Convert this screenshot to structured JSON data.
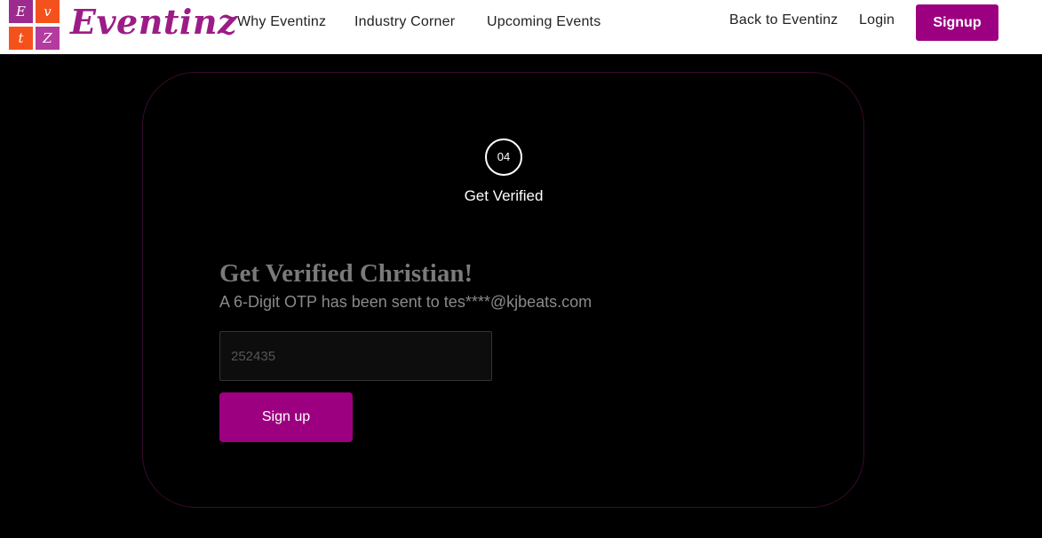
{
  "header": {
    "logo": {
      "tiles": [
        "E",
        "v",
        "t",
        "Z"
      ],
      "text": "Eventinz",
      "brand_color": "#9c1c87"
    },
    "nav": {
      "why": "Why Eventinz",
      "industry": "Industry Corner",
      "upcoming": "Upcoming Events"
    },
    "back_link": "Back to Eventinz",
    "login": "Login",
    "signup": "Signup"
  },
  "card": {
    "step": {
      "number": "04",
      "label": "Get Verified"
    },
    "heading": "Get Verified Christian!",
    "subtext": "A 6-Digit OTP has been sent to tes****@kjbeats.com",
    "otp_input": {
      "placeholder": "252435",
      "value": ""
    },
    "submit": "Sign up"
  },
  "colors": {
    "accent": "#9c0080",
    "background": "#000000",
    "card_border": "#3a0a2e"
  }
}
